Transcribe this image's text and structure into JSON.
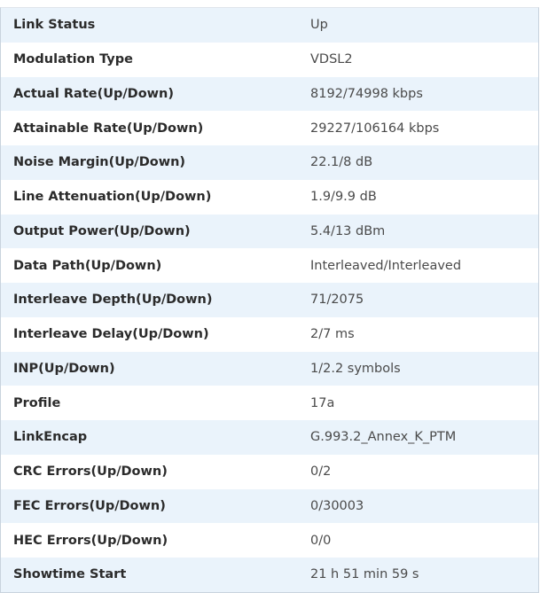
{
  "rows": [
    {
      "label": "Link Status",
      "value": "Up"
    },
    {
      "label": "Modulation Type",
      "value": "VDSL2"
    },
    {
      "label": "Actual Rate(Up/Down)",
      "value": "8192/74998 kbps"
    },
    {
      "label": "Attainable Rate(Up/Down)",
      "value": "29227/106164 kbps"
    },
    {
      "label": "Noise Margin(Up/Down)",
      "value": "22.1/8 dB"
    },
    {
      "label": "Line Attenuation(Up/Down)",
      "value": "1.9/9.9 dB"
    },
    {
      "label": "Output Power(Up/Down)",
      "value": "5.4/13 dBm"
    },
    {
      "label": "Data Path(Up/Down)",
      "value": "Interleaved/Interleaved"
    },
    {
      "label": "Interleave Depth(Up/Down)",
      "value": "71/2075"
    },
    {
      "label": "Interleave Delay(Up/Down)",
      "value": "2/7 ms"
    },
    {
      "label": "INP(Up/Down)",
      "value": "1/2.2 symbols"
    },
    {
      "label": "Profile",
      "value": "17a"
    },
    {
      "label": "LinkEncap",
      "value": "G.993.2_Annex_K_PTM"
    },
    {
      "label": "CRC Errors(Up/Down)",
      "value": "0/2"
    },
    {
      "label": "FEC Errors(Up/Down)",
      "value": "0/30003"
    },
    {
      "label": "HEC Errors(Up/Down)",
      "value": "0/0"
    },
    {
      "label": "Showtime Start",
      "value": "21 h 51 min 59 s"
    }
  ],
  "colors": {
    "row_stripe": "#eaf3fb",
    "row_plain": "#ffffff",
    "label_text": "#2b2b2b",
    "value_text": "#4a4a4a"
  }
}
